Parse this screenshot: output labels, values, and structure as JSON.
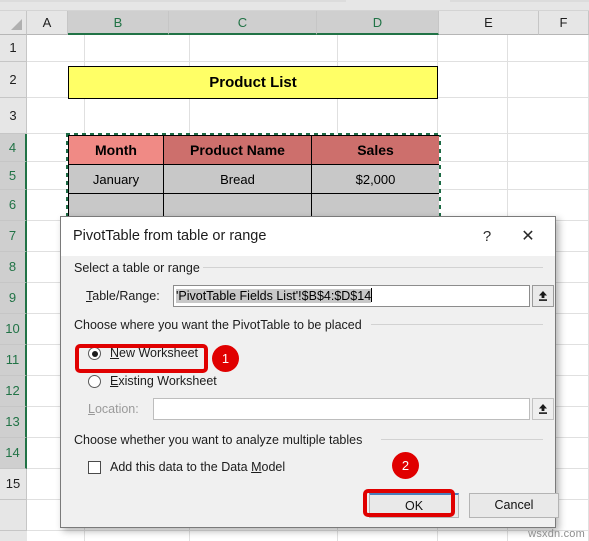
{
  "spreadsheet": {
    "column_headers": [
      {
        "label": "A",
        "selected": false
      },
      {
        "label": "B",
        "selected": true
      },
      {
        "label": "C",
        "selected": true
      },
      {
        "label": "D",
        "selected": true
      },
      {
        "label": "E",
        "selected": false
      },
      {
        "label": "F",
        "selected": false
      }
    ],
    "row_headers": [
      {
        "label": "1",
        "selected": false
      },
      {
        "label": "2",
        "selected": false
      },
      {
        "label": "3",
        "selected": false
      },
      {
        "label": "4",
        "selected": true
      },
      {
        "label": "5",
        "selected": true
      },
      {
        "label": "6",
        "selected": true
      },
      {
        "label": "7",
        "selected": true
      },
      {
        "label": "8",
        "selected": true
      },
      {
        "label": "9",
        "selected": true
      },
      {
        "label": "10",
        "selected": true
      },
      {
        "label": "11",
        "selected": true
      },
      {
        "label": "12",
        "selected": true
      },
      {
        "label": "13",
        "selected": true
      },
      {
        "label": "14",
        "selected": true
      },
      {
        "label": "15",
        "selected": false
      }
    ],
    "title_cell": {
      "text": "Product List",
      "fill": "#ffff66",
      "border": "#000000"
    },
    "table": {
      "headers": [
        "Month",
        "Product Name",
        "Sales"
      ],
      "header_fills": [
        "#f08a85",
        "#cd6f6c",
        "#cd6f6c"
      ],
      "data_fill": "#c8c8c8",
      "rows": [
        [
          "January",
          "Bread",
          "$2,000"
        ]
      ]
    },
    "selection_color": "#217346"
  },
  "dialog": {
    "title": "PivotTable from table or range",
    "help_icon": "question-mark-icon",
    "help_label": "?",
    "close_icon": "close-icon",
    "close_label": "✕",
    "group_source": {
      "label": "Select a table or range"
    },
    "table_range": {
      "label_prefix": "T",
      "label_rest": "able/Range:",
      "value": "'PivotTable Fields List'!$B$4:$D$14",
      "picker_icon": "collapse-dialog-icon"
    },
    "group_placement": {
      "label": "Choose where you want the PivotTable to be placed"
    },
    "new_worksheet": {
      "label_prefix": "N",
      "label_rest": "ew Worksheet",
      "checked": true
    },
    "existing_worksheet": {
      "label_prefix": "E",
      "label_rest": "xisting Worksheet",
      "checked": false
    },
    "location": {
      "label_prefix": "L",
      "label_rest": "ocation:",
      "value": "",
      "disabled": true,
      "picker_icon": "collapse-dialog-icon"
    },
    "group_multiple": {
      "label": "Choose whether you want to analyze multiple tables"
    },
    "data_model": {
      "label_pre": "Add this data to the Data ",
      "label_prefix": "M",
      "label_rest": "odel",
      "checked": false
    },
    "buttons": {
      "ok": "OK",
      "cancel": "Cancel"
    }
  },
  "annotations": {
    "accent_color": "#e00000",
    "badge_one": "1",
    "badge_two": "2"
  },
  "watermark": "wsxdn.com"
}
